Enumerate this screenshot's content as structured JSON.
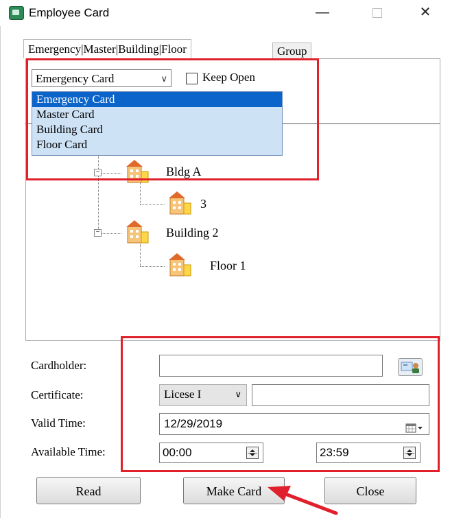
{
  "window": {
    "title": "Employee Card",
    "minimize_glyph": "—",
    "close_glyph": "✕"
  },
  "tabs": [
    {
      "label": "Emergency|Master|Building|Floor"
    },
    {
      "label": "Group"
    }
  ],
  "card_type": {
    "selected": "Emergency Card",
    "arrow": "∨",
    "options": [
      "Emergency Card",
      "Master Card",
      "Building Card",
      "Floor Card"
    ],
    "keep_open_label": "Keep Open",
    "keep_open_checked": false
  },
  "tree": {
    "nodes": [
      {
        "label": "Bldg A",
        "icon": "building-icon"
      },
      {
        "label": "3",
        "icon": "building-icon"
      },
      {
        "label": "Building 2",
        "icon": "building-icon"
      },
      {
        "label": "Floor 1",
        "icon": "building-icon"
      }
    ],
    "expander_glyph": "−"
  },
  "form": {
    "cardholder_label": "Cardholder:",
    "cardholder_value": "",
    "cardholder_icon": "contact-card-icon",
    "certificate_label": "Certificate:",
    "certificate_type": "Licese I",
    "certificate_arrow": "∨",
    "certificate_value": "",
    "valid_time_label": "Valid Time:",
    "valid_time_value": "12/29/2019",
    "calendar_icon": "calendar-icon",
    "available_time_label": "Available Time:",
    "start_time": "00:00",
    "end_time": "23:59"
  },
  "buttons": {
    "read": "Read",
    "make_card": "Make Card",
    "close": "Close"
  },
  "colors": {
    "highlight": "#e0202a",
    "selection": "#0a64c9",
    "dropdown_bg": "#cde2f5"
  }
}
